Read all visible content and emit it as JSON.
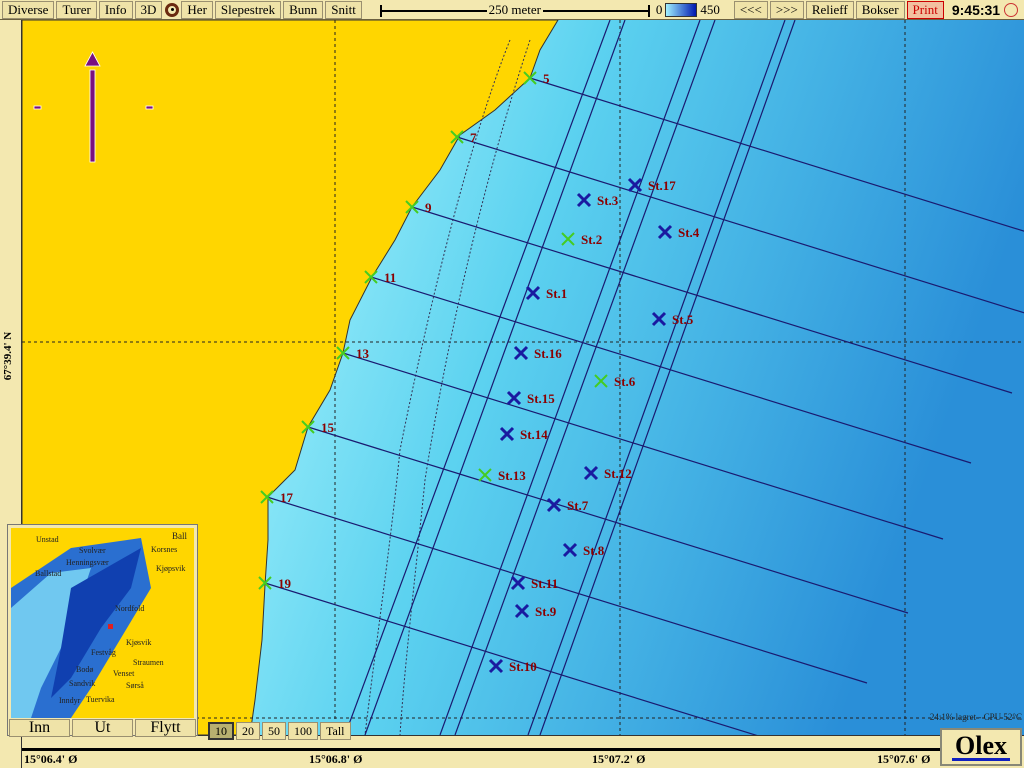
{
  "toolbar": {
    "buttons": [
      "Diverse",
      "Turer",
      "Info",
      "3D",
      "Her",
      "Slepestrek",
      "Bunn",
      "Snitt"
    ],
    "scale_label": "250 meter",
    "depth_min": "0",
    "depth_max": "450",
    "nav_buttons": [
      "<<<",
      ">>>",
      "Relieff",
      "Bokser",
      "Print"
    ],
    "clock": "9:45:31"
  },
  "axes": {
    "lat_label": "67°39.4' N",
    "lon_labels": [
      "15°06.4' Ø",
      "15°06.8' Ø",
      "15°07.2' Ø",
      "15°07.6' Ø"
    ]
  },
  "colors": {
    "land": "#ffd600",
    "shallow": "#a8f4fc",
    "deep": "#2a8fd8",
    "station_blue": "#1a1aa0",
    "marker_green": "#44cc22",
    "label": "#8b0000",
    "track": "#1a1a70"
  },
  "markers": [
    {
      "label": "5",
      "type": "green"
    },
    {
      "label": "7",
      "type": "green"
    },
    {
      "label": "9",
      "type": "green"
    },
    {
      "label": "11",
      "type": "green"
    },
    {
      "label": "13",
      "type": "green"
    },
    {
      "label": "15",
      "type": "green"
    },
    {
      "label": "17",
      "type": "green"
    },
    {
      "label": "19",
      "type": "green"
    },
    {
      "label": "St.17",
      "type": "blue"
    },
    {
      "label": "St.3",
      "type": "blue"
    },
    {
      "label": "St.4",
      "type": "blue"
    },
    {
      "label": "St.2",
      "type": "green"
    },
    {
      "label": "St.1",
      "type": "blue"
    },
    {
      "label": "St.5",
      "type": "blue"
    },
    {
      "label": "St.16",
      "type": "blue"
    },
    {
      "label": "St.6",
      "type": "green"
    },
    {
      "label": "St.15",
      "type": "blue"
    },
    {
      "label": "St.14",
      "type": "blue"
    },
    {
      "label": "St.13",
      "type": "green"
    },
    {
      "label": "St.12",
      "type": "blue"
    },
    {
      "label": "St.7",
      "type": "blue"
    },
    {
      "label": "St.8",
      "type": "blue"
    },
    {
      "label": "St.11",
      "type": "blue"
    },
    {
      "label": "St.9",
      "type": "blue"
    },
    {
      "label": "St.10",
      "type": "blue"
    }
  ],
  "minimap": {
    "places": [
      "Unstad",
      "Svolvær",
      "Henningsvær",
      "Ballstad",
      "Korsnes",
      "Kjøpsvik",
      "Nordfold",
      "Kjøsvik",
      "Festvåg",
      "Straumen",
      "Bodø",
      "Venset",
      "Sandvik",
      "Sørså",
      "Inndyr",
      "Tuervika",
      "Ball"
    ],
    "buttons": [
      "Inn",
      "Ut",
      "Flytt"
    ]
  },
  "zoom_buttons": {
    "items": [
      "10",
      "20",
      "50",
      "100",
      "Tall"
    ],
    "selected": "10"
  },
  "status": "24:1% lagret - CPU 52°C",
  "logo": "Olex"
}
